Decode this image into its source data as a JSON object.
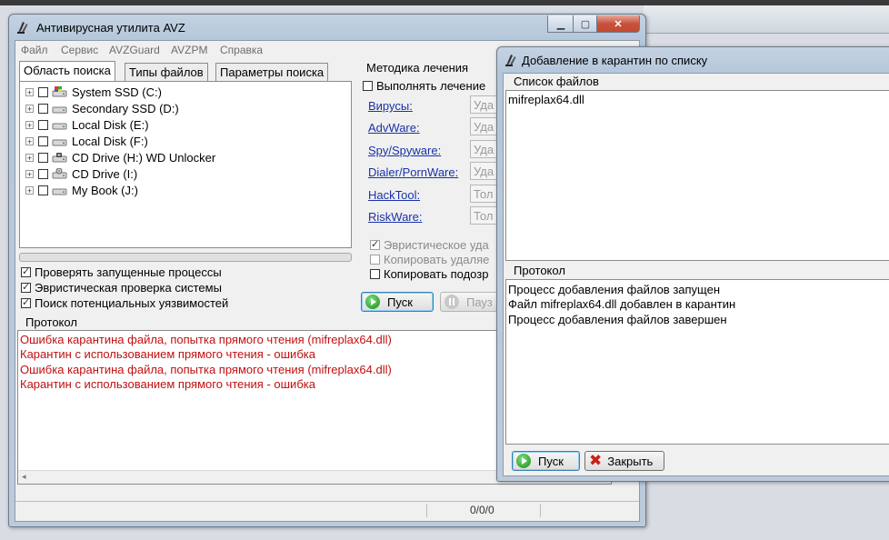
{
  "main_window": {
    "title": "Антивирусная утилита AVZ",
    "menu": [
      "Файл",
      "Сервис",
      "AVZGuard",
      "AVZPM",
      "Справка"
    ],
    "tabs": [
      "Область поиска",
      "Типы файлов",
      "Параметры поиска"
    ],
    "drives": [
      {
        "label": "System SSD (C:)",
        "icon": "system-drive-icon"
      },
      {
        "label": "Secondary SSD (D:)",
        "icon": "hard-drive-icon"
      },
      {
        "label": "Local Disk (E:)",
        "icon": "hard-drive-icon"
      },
      {
        "label": "Local Disk (F:)",
        "icon": "hard-drive-icon"
      },
      {
        "label": "CD Drive (H:) WD Unlocker",
        "icon": "locked-drive-icon"
      },
      {
        "label": "CD Drive (I:)",
        "icon": "cd-drive-icon"
      },
      {
        "label": "My Book (J:)",
        "icon": "hard-drive-icon"
      }
    ],
    "checks": [
      {
        "label": "Проверять запущенные процессы",
        "checked": true
      },
      {
        "label": "Эвристическая проверка системы",
        "checked": true
      },
      {
        "label": "Поиск потенциальных уязвимостей",
        "checked": true
      }
    ],
    "treatment": {
      "title": "Методика лечения",
      "perform_label": "Выполнять лечение",
      "categories": [
        {
          "label": "Вирусы:",
          "value": "Уда"
        },
        {
          "label": "AdvWare:",
          "value": "Уда"
        },
        {
          "label": "Spy/Spyware:",
          "value": "Уда"
        },
        {
          "label": "Dialer/PornWare:",
          "value": "Уда"
        },
        {
          "label": "HackTool:",
          "value": "Тол"
        },
        {
          "label": "RiskWare:",
          "value": "Тол"
        }
      ],
      "options": [
        {
          "label": "Эвристическое уда",
          "checked": true
        },
        {
          "label": "Копировать удаляе",
          "checked": false
        },
        {
          "label": "Копировать подозр",
          "checked": false
        }
      ]
    },
    "start_label": "Пуск",
    "pause_label": "Пауз",
    "protocol_title": "Протокол",
    "log": [
      "Ошибка карантина файла, попытка прямого чтения (mifreplax64.dll)",
      " Карантин с использованием прямого чтения - ошибка",
      "Ошибка карантина файла, попытка прямого чтения (mifreplax64.dll)",
      " Карантин с использованием прямого чтения - ошибка"
    ],
    "status_counter": "0/0/0"
  },
  "dialog": {
    "title": "Добавление в карантин по списку",
    "files_title": "Список файлов",
    "files": [
      "mifreplax64.dll"
    ],
    "protocol_title": "Протокол",
    "log": [
      "Процесс добавления файлов запущен",
      "Файл mifreplax64.dll добавлен в карантин",
      "Процесс добавления файлов завершен"
    ],
    "start_label": "Пуск",
    "close_label": "Закрыть"
  },
  "colors": {
    "log_error": "#c01010",
    "link": "#1a32a8"
  }
}
